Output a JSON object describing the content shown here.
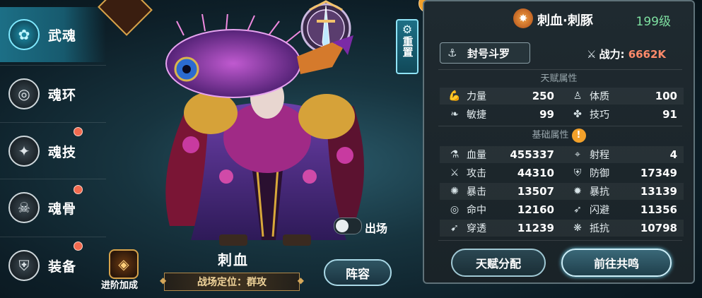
{
  "nav": {
    "items": [
      {
        "label": "武魂",
        "icon": "sprout-icon",
        "active": true,
        "badge": false
      },
      {
        "label": "魂环",
        "icon": "ring-icon",
        "active": false,
        "badge": false
      },
      {
        "label": "魂技",
        "icon": "compass-skill-icon",
        "active": false,
        "badge": true
      },
      {
        "label": "魂骨",
        "icon": "bone-icon",
        "active": false,
        "badge": true
      },
      {
        "label": "装备",
        "icon": "shield-equip-icon",
        "active": false,
        "badge": true
      }
    ]
  },
  "center": {
    "reset_label": "重置",
    "character_name": "刺血",
    "deploy_label": "出场",
    "deploy_on": false,
    "advance_label": "进阶加成",
    "role_label": "战场定位：群攻",
    "lineup_label": "阵容"
  },
  "panel": {
    "spirit_name": "刺血·刺豚",
    "level": "199级",
    "title": "封号斗罗",
    "power_label": "战力:",
    "power_value": "6662K",
    "talent_section": "天赋属性",
    "talent_stats": [
      {
        "name": "力量",
        "value": "250",
        "icon": "arm-icon"
      },
      {
        "name": "体质",
        "value": "100",
        "icon": "body-icon"
      },
      {
        "name": "敏捷",
        "value": "99",
        "icon": "feather-icon"
      },
      {
        "name": "技巧",
        "value": "91",
        "icon": "technique-icon"
      }
    ],
    "base_section": "基础属性",
    "base_stats": [
      {
        "name": "血量",
        "value": "455337",
        "icon": "potion-icon"
      },
      {
        "name": "射程",
        "value": "4",
        "icon": "crosshair-icon"
      },
      {
        "name": "攻击",
        "value": "44310",
        "icon": "sword-icon"
      },
      {
        "name": "防御",
        "value": "17349",
        "icon": "shield-icon"
      },
      {
        "name": "暴击",
        "value": "13507",
        "icon": "crit-icon"
      },
      {
        "name": "暴抗",
        "value": "13139",
        "icon": "crit-resist-icon"
      },
      {
        "name": "命中",
        "value": "12160",
        "icon": "hit-icon"
      },
      {
        "name": "闪避",
        "value": "11356",
        "icon": "dodge-icon"
      },
      {
        "name": "穿透",
        "value": "11239",
        "icon": "pierce-icon"
      },
      {
        "name": "抵抗",
        "value": "10798",
        "icon": "resist-icon"
      }
    ],
    "btn_talent": "天赋分配",
    "btn_resonance": "前往共鸣"
  },
  "colors": {
    "level": "#7ee0a1",
    "power": "#ff8a6a",
    "accent": "#1c6f86"
  }
}
